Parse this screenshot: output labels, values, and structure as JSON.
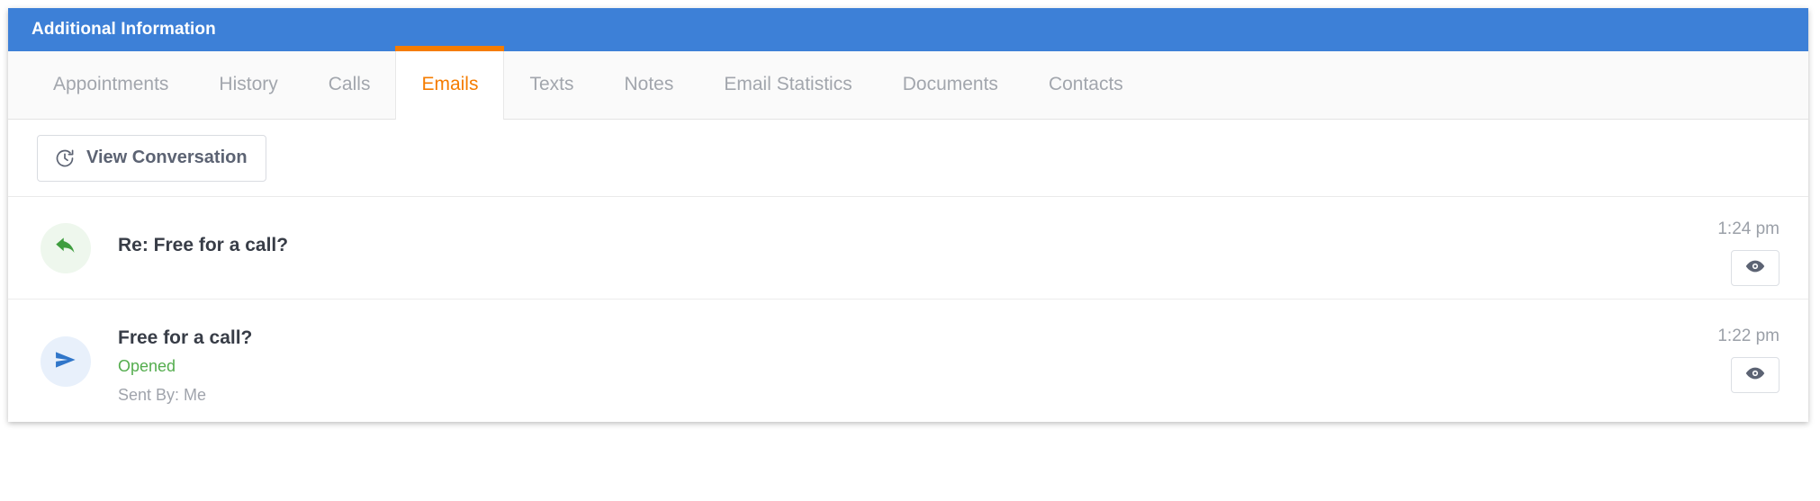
{
  "panel": {
    "title": "Additional Information",
    "header_color": "#3d80d7",
    "accent_color": "#f57c00"
  },
  "tabs": [
    {
      "label": "Appointments",
      "active": false
    },
    {
      "label": "History",
      "active": false
    },
    {
      "label": "Calls",
      "active": false
    },
    {
      "label": "Emails",
      "active": true
    },
    {
      "label": "Texts",
      "active": false
    },
    {
      "label": "Notes",
      "active": false
    },
    {
      "label": "Email Statistics",
      "active": false
    },
    {
      "label": "Documents",
      "active": false
    },
    {
      "label": "Contacts",
      "active": false
    }
  ],
  "toolbar": {
    "view_conversation_label": "View Conversation",
    "view_conversation_icon": "clock-history-icon"
  },
  "emails": [
    {
      "icon": "reply-arrow-icon",
      "icon_color": "#3f9d3f",
      "subject": "Re: Free for a call?",
      "status": "",
      "sent_by": "",
      "time": "1:24 pm",
      "action_icon": "eye-icon"
    },
    {
      "icon": "send-paper-plane-icon",
      "icon_color": "#3076c9",
      "subject": "Free for a call?",
      "status": "Opened",
      "status_color": "#54ad4e",
      "sent_by": "Sent By: Me",
      "time": "1:22 pm",
      "action_icon": "eye-icon"
    }
  ]
}
